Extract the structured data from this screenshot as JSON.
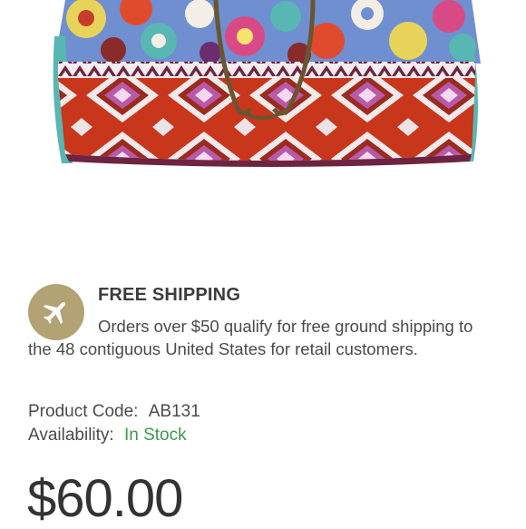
{
  "shipping": {
    "icon": "airplane-icon",
    "title": "FREE SHIPPING",
    "text": "Orders over $50 qualify for free ground shipping to the 48 contiguous United States for retail customers."
  },
  "product": {
    "code_label": "Product Code:",
    "code_value": "AB131",
    "availability_label": "Availability:",
    "availability_value": "In Stock",
    "price": "$60.00"
  },
  "colors": {
    "icon_bg": "#b3a273",
    "in_stock": "#3c9a4a",
    "bag_red": "#c8361c",
    "bag_teal": "#58b7b2",
    "bag_purple": "#8a4a8a"
  }
}
